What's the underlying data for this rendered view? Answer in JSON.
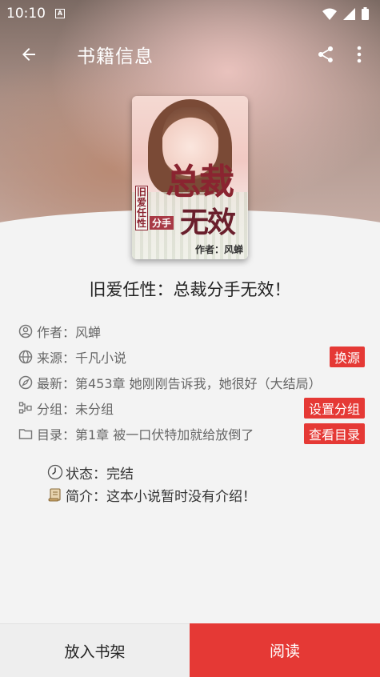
{
  "status_bar": {
    "time": "10:10",
    "notification": "A"
  },
  "toolbar": {
    "title": "书籍信息"
  },
  "book": {
    "title": "旧爱任性：总裁分手无效！",
    "cover": {
      "title_top": "总裁",
      "title_bottom": "无效",
      "side_label": "旧爱任性",
      "split_label": "分手",
      "author_line": "作者：风蝉"
    }
  },
  "info": {
    "author": "作者：风蝉",
    "source": "来源：千凡小说",
    "source_button": "换源",
    "latest": "最新：第453章 她刚刚告诉我，她很好（大结局）",
    "group": "分组：未分组",
    "group_button": "设置分组",
    "toc": "目录：第1章 被一口伏特加就给放倒了",
    "toc_button": "查看目录"
  },
  "extra": {
    "status": "状态：完结",
    "intro": "简介：这本小说暂时没有介绍！"
  },
  "actions": {
    "add_to_shelf": "放入书架",
    "read": "阅读"
  },
  "colors": {
    "accent": "#e53935",
    "background": "#f3f3f3"
  }
}
